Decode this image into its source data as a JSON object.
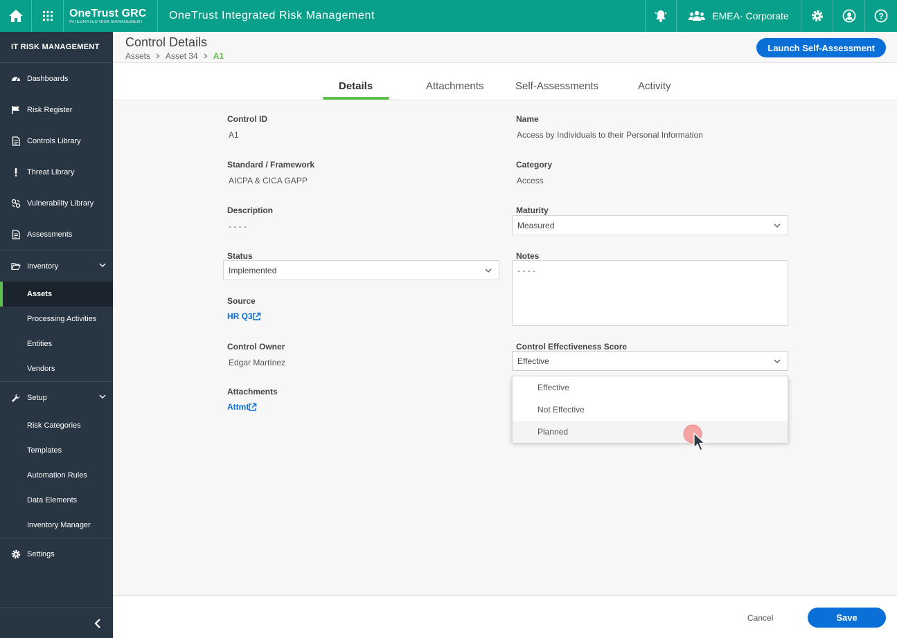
{
  "topbar": {
    "brand": "OneTrust GRC",
    "brand_sub": "INTEGRATED RISK MANAGEMENT",
    "title": "OneTrust Integrated Risk Management",
    "org": "EMEA- Corporate"
  },
  "sidebar": {
    "header": "IT RISK MANAGEMENT",
    "items": [
      {
        "label": "Dashboards",
        "icon": "dashboard-icon"
      },
      {
        "label": "Risk Register",
        "icon": "flag-icon"
      },
      {
        "label": "Controls Library",
        "icon": "document-icon"
      },
      {
        "label": "Threat Library",
        "icon": "exclamation-icon"
      },
      {
        "label": "Vulnerability Library",
        "icon": "bug-icon"
      },
      {
        "label": "Assessments",
        "icon": "document-icon"
      }
    ],
    "inventory": {
      "label": "Inventory",
      "subitems": [
        "Assets",
        "Processing Activities",
        "Entities",
        "Vendors"
      ]
    },
    "setup": {
      "label": "Setup",
      "subitems": [
        "Risk Categories",
        "Templates",
        "Automation Rules",
        "Data Elements",
        "Inventory Manager"
      ]
    },
    "settings": "Settings"
  },
  "header": {
    "title": "Control Details",
    "breadcrumb": [
      "Assets",
      "Asset 34",
      "A1"
    ],
    "launch_label": "Launch Self-Assessment"
  },
  "tabs": [
    "Details",
    "Attachments",
    "Self-Assessments",
    "Activity"
  ],
  "details": {
    "control_id_label": "Control ID",
    "control_id": "A1",
    "name_label": "Name",
    "name": "Access by Individuals to their Personal Information",
    "standard_label": "Standard / Framework",
    "standard": "AICPA & CICA GAPP",
    "category_label": "Category",
    "category": "Access",
    "description_label": "Description",
    "description": "- - - -",
    "maturity_label": "Maturity",
    "maturity": "Measured",
    "status_label": "Status",
    "status": "Implemented",
    "notes_label": "Notes",
    "notes": "- - - -",
    "source_label": "Source",
    "source": "HR Q3",
    "owner_label": "Control Owner",
    "owner": "Edgar Martínez",
    "effectiveness_label": "Control Effectiveness Score",
    "effectiveness": "Effective",
    "effectiveness_options": [
      "Effective",
      "Not Effective",
      "Planned"
    ],
    "attachments_label": "Attachments",
    "attachments": "Attmt"
  },
  "footer": {
    "cancel_label": "Cancel",
    "save_label": "Save"
  },
  "colors": {
    "teal": "#08a08a",
    "sidebar": "#283542",
    "accent_green": "#5cbf49",
    "primary_blue": "#0a6fd6"
  }
}
